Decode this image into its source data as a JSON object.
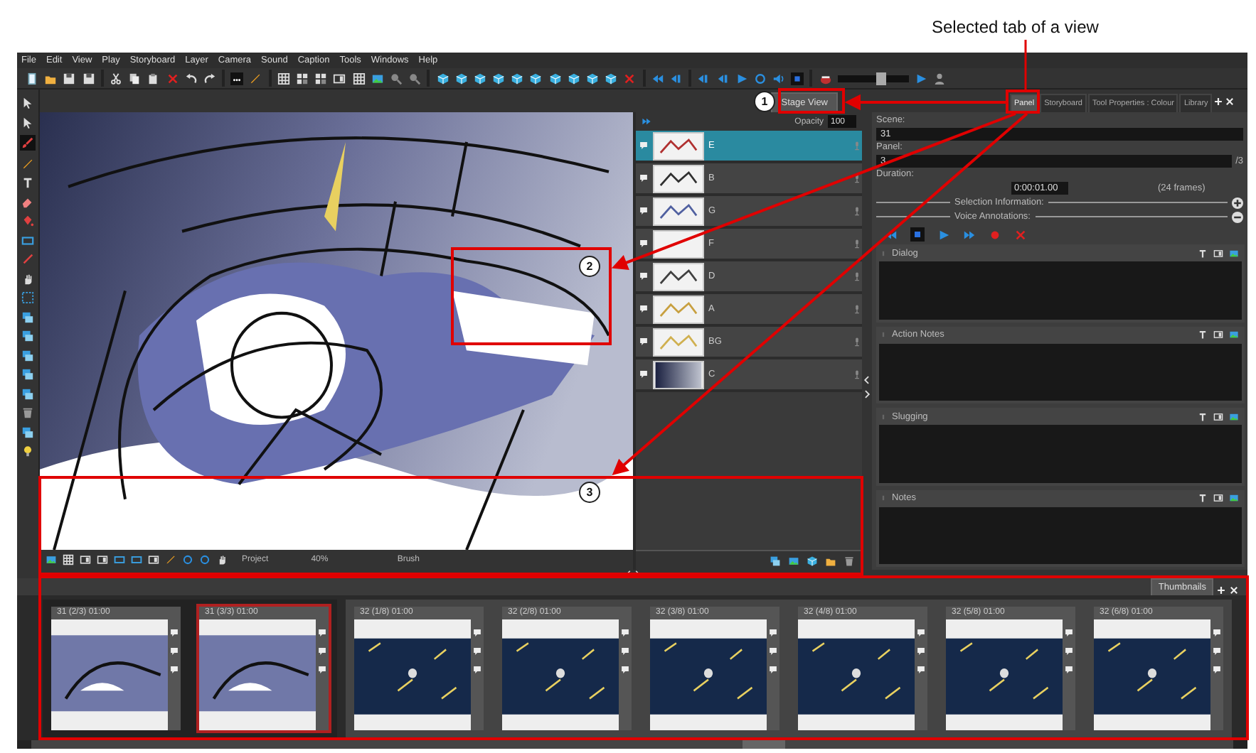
{
  "caption": "Selected tab of a view",
  "callouts": [
    "1",
    "2",
    "3"
  ],
  "menu": [
    "File",
    "Edit",
    "View",
    "Play",
    "Storyboard",
    "Layer",
    "Camera",
    "Sound",
    "Caption",
    "Tools",
    "Windows",
    "Help"
  ],
  "toolbar": {
    "slider": {
      "level": 0.6
    }
  },
  "stage_view": {
    "tab": {
      "label": "Stage View",
      "selected": true
    },
    "status": {
      "mode": "Project",
      "zoom": "40%",
      "tool": "Brush"
    }
  },
  "layers": {
    "opacity_label": "Opacity",
    "opacity": "100",
    "items": [
      {
        "name": "E",
        "selected": true,
        "kind": "lines",
        "color": "#b03030"
      },
      {
        "name": "B",
        "selected": false,
        "kind": "lines",
        "color": "#303030"
      },
      {
        "name": "G",
        "selected": false,
        "kind": "lines",
        "color": "#5060a0"
      },
      {
        "name": "F",
        "selected": false,
        "kind": "blank"
      },
      {
        "name": "D",
        "selected": false,
        "kind": "lines",
        "color": "#404040"
      },
      {
        "name": "A",
        "selected": false,
        "kind": "lines",
        "color": "#c8a040"
      },
      {
        "name": "BG",
        "selected": false,
        "kind": "lines",
        "color": "#d0b050"
      },
      {
        "name": "C",
        "selected": false,
        "kind": "gradient"
      }
    ]
  },
  "panel_view": {
    "tabs": [
      {
        "label": "Panel",
        "selected": true
      },
      {
        "label": "Storyboard",
        "selected": false
      },
      {
        "label": "Tool Properties : Colour",
        "selected": false
      },
      {
        "label": "Library",
        "selected": false
      }
    ],
    "scene_label": "Scene:",
    "scene": "31",
    "panel_label": "Panel:",
    "panel": "3",
    "panel_total": "/3",
    "duration_label": "Duration:",
    "duration": "0:00:01.00",
    "frames": "(24 frames)",
    "sections": [
      {
        "label": "Selection Information:",
        "expanded": false
      },
      {
        "label": "Voice Annotations:",
        "expanded": true
      }
    ],
    "captions": [
      "Dialog",
      "Action Notes",
      "Slugging",
      "Notes"
    ]
  },
  "thumbnails": {
    "tab": {
      "label": "Thumbnails",
      "selected": true
    },
    "scenes": [
      {
        "panels": [
          {
            "label": "31 (2/3) 01:00",
            "selected": false,
            "kind": "sketch"
          },
          {
            "label": "31 (3/3) 01:00",
            "selected": true,
            "kind": "sketch"
          }
        ]
      },
      {
        "panels": [
          {
            "label": "32 (1/8) 01:00",
            "selected": false,
            "kind": "space"
          },
          {
            "label": "32 (2/8) 01:00",
            "selected": false,
            "kind": "space"
          },
          {
            "label": "32 (3/8) 01:00",
            "selected": false,
            "kind": "space"
          },
          {
            "label": "32 (4/8) 01:00",
            "selected": false,
            "kind": "space"
          },
          {
            "label": "32 (5/8) 01:00",
            "selected": false,
            "kind": "space"
          },
          {
            "label": "32 (6/8) 01:00",
            "selected": false,
            "kind": "space"
          }
        ]
      }
    ]
  }
}
